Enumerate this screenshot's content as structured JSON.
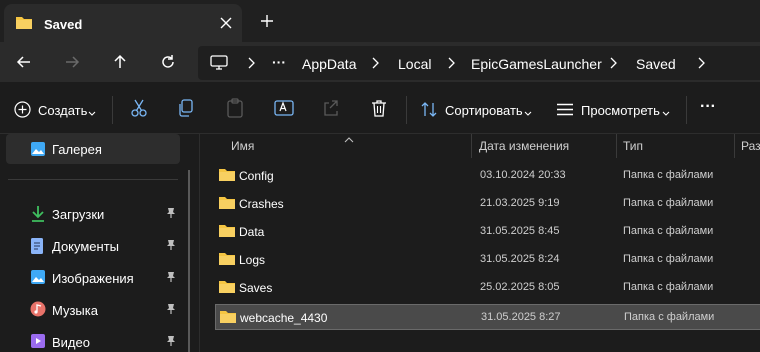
{
  "tab": {
    "title": "Saved"
  },
  "breadcrumb": {
    "more": "···",
    "items": [
      "AppData",
      "Local",
      "EpicGamesLauncher",
      "Saved"
    ]
  },
  "toolbar": {
    "create_label": "Создать",
    "sort_label": "Сортировать",
    "view_label": "Просмотреть",
    "more_label": "···"
  },
  "sidebar": {
    "gallery": "Галерея",
    "items": [
      {
        "label": "Загрузки",
        "icon": "download-icon",
        "color": "#3fbf5f"
      },
      {
        "label": "Документы",
        "icon": "document-icon",
        "color": "#8ab4f8"
      },
      {
        "label": "Изображения",
        "icon": "picture-icon",
        "color": "#3fa9f5"
      },
      {
        "label": "Музыка",
        "icon": "music-icon",
        "color": "#e8736a"
      },
      {
        "label": "Видео",
        "icon": "video-icon",
        "color": "#9b6cf0"
      }
    ]
  },
  "columns": {
    "name": "Имя",
    "date": "Дата изменения",
    "type": "Тип",
    "size": "Раз"
  },
  "files": [
    {
      "name": "Config",
      "date": "03.10.2024 20:33",
      "type": "Папка с файлами"
    },
    {
      "name": "Crashes",
      "date": "21.03.2025 9:19",
      "type": "Папка с файлами"
    },
    {
      "name": "Data",
      "date": "31.05.2025 8:45",
      "type": "Папка с файлами"
    },
    {
      "name": "Logs",
      "date": "31.05.2025 8:24",
      "type": "Папка с файлами"
    },
    {
      "name": "Saves",
      "date": "25.02.2025 8:05",
      "type": "Папка с файлами"
    },
    {
      "name": "webcache_4430",
      "date": "31.05.2025 8:27",
      "type": "Папка с файлами"
    }
  ],
  "selected_file": "webcache_4430",
  "colors": {
    "folder": "#f5c542",
    "accent": "#4cc2ff",
    "background": "#1c1c1c"
  }
}
